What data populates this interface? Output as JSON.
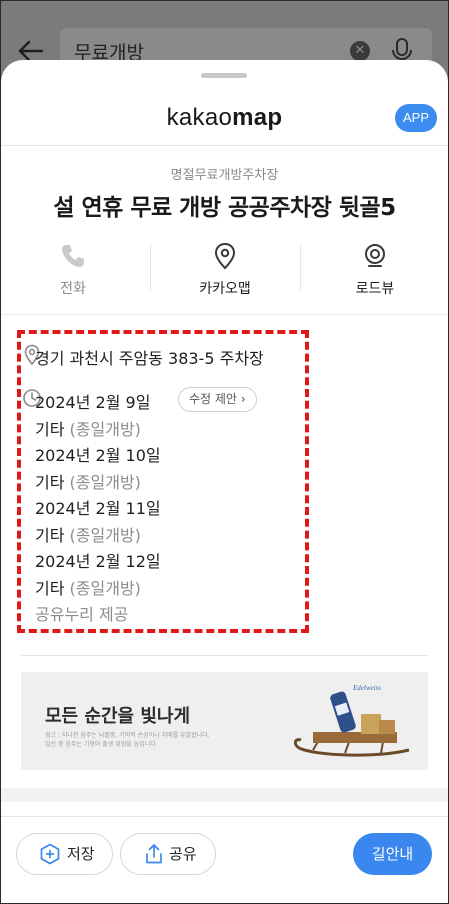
{
  "search": {
    "query": "무료개방"
  },
  "sheet": {
    "logo_bold": "kakao",
    "logo_light": "map",
    "app_button": "APP"
  },
  "place": {
    "category": "명절무료개방주차장",
    "title": "설 연휴 무료 개방 공공주차장 뒷골5"
  },
  "actions": [
    {
      "label": "전화",
      "icon": "phone-icon",
      "enabled": false
    },
    {
      "label": "카카오맵",
      "icon": "location-pin-icon",
      "enabled": true
    },
    {
      "label": "로드뷰",
      "icon": "roadview-camera-icon",
      "enabled": true
    }
  ],
  "info": {
    "address": "경기 과천시 주암동 383-5 주차장",
    "suggest_edit": "수정 제안",
    "hours": [
      {
        "date": "2024년 2월 9일",
        "type": "기타",
        "note": "(종일개방)"
      },
      {
        "date": "2024년 2월 10일",
        "type": "기타",
        "note": "(종일개방)"
      },
      {
        "date": "2024년 2월 11일",
        "type": "기타",
        "note": "(종일개방)"
      },
      {
        "date": "2024년 2월 12일",
        "type": "기타",
        "note": "(종일개방)"
      }
    ],
    "source": "공유누리 제공"
  },
  "ad": {
    "headline": "모든 순간을 빛나게",
    "fine_print_1": "경고 : 지나친 음주는 뇌졸중, 기억력 손상이나 치매를 유발합니다.",
    "fine_print_2": "임신 중 음주는 기형아 출생 위험을 높입니다.",
    "brand": "Edelweiss"
  },
  "bottom_bar": {
    "save_label": "저장",
    "share_label": "공유",
    "directions_label": "길안내"
  },
  "colors": {
    "accent_blue": "#3a87ef",
    "highlight_red": "#e01818"
  }
}
